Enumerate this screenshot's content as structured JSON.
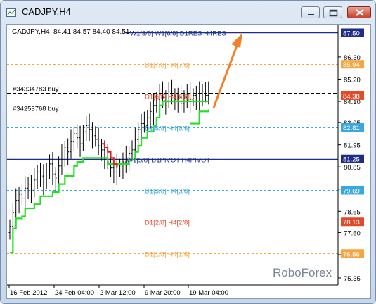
{
  "window": {
    "title": "CADJPY,H4"
  },
  "chart_info": {
    "symbol_line": "CADJPY,H4",
    "ohlc": "84.41 84.57 84.40 84.51"
  },
  "watermark": "RoboForex",
  "y_axis": {
    "ticks": [
      "86.30",
      "85.20",
      "84.10",
      "83.05",
      "81.95",
      "80.85",
      "79.75",
      "78.65",
      "77.60",
      "76.50",
      "75.35"
    ],
    "price_tags": [
      {
        "label": "87.50",
        "value": 87.5,
        "color": "#1f2d8a",
        "text_color": "#ffffff"
      },
      {
        "label": "85.94",
        "value": 85.94,
        "color": "#f4a640",
        "text_color": "#ffffff"
      },
      {
        "label": "84.38",
        "value": 84.38,
        "color": "#e34a2a",
        "text_color": "#ffffff"
      },
      {
        "label": "82.81",
        "value": 82.81,
        "color": "#3aa7e0",
        "text_color": "#ffffff"
      },
      {
        "label": "81.25",
        "value": 81.25,
        "color": "#1f2d8a",
        "text_color": "#ffffff"
      },
      {
        "label": "79.69",
        "value": 79.69,
        "color": "#3aa7e0",
        "text_color": "#ffffff"
      },
      {
        "label": "78.13",
        "value": 78.13,
        "color": "#e34a2a",
        "text_color": "#ffffff"
      },
      {
        "label": "76.56",
        "value": 76.56,
        "color": "#f4a640",
        "text_color": "#ffffff"
      }
    ]
  },
  "x_axis": {
    "ticks": [
      "16 Feb 2012",
      "24 Feb 04:00",
      "2 Mar 12:00",
      "9 Mar 20:00",
      "19 Mar 04:00"
    ]
  },
  "levels": [
    {
      "label": "W1[3/8] W1[6/8] D1RES H4RES",
      "value": 87.5,
      "color": "#1f2d8a"
    },
    {
      "label": "D1[7/8] H4[7/8]",
      "value": 85.94,
      "color": "#f4a640"
    },
    {
      "label": "D1[6/8] H4[6/8]",
      "value": 84.38,
      "color": "#e34a2a"
    },
    {
      "label": "D1[5/8] H4[5/8]",
      "value": 82.81,
      "color": "#3aa7e0"
    },
    {
      "label": "W1[5/8] D1PIVOT H4PIVOT",
      "value": 81.25,
      "color": "#1f2d8a"
    },
    {
      "label": "D1[3/8] H4[3/8]",
      "value": 79.69,
      "color": "#3aa7e0"
    },
    {
      "label": "D1[2/8] H4[2/8]",
      "value": 78.13,
      "color": "#e34a2a"
    },
    {
      "label": "D1[1/8] H4[1/8]",
      "value": 76.56,
      "color": "#f4a640"
    }
  ],
  "orders": [
    {
      "label": "#34334783 buy",
      "value": 84.51
    },
    {
      "label": "#34253768 buy",
      "value": 83.55
    }
  ],
  "chart_data": {
    "type": "candlestick",
    "ylim": [
      75.0,
      87.9
    ],
    "prices": [
      77.9,
      78.6,
      79.2,
      79.5,
      79.3,
      79.8,
      80.0,
      79.7,
      80.2,
      80.6,
      80.4,
      80.1,
      80.7,
      81.0,
      80.5,
      80.3,
      80.9,
      81.4,
      81.8,
      81.6,
      82.1,
      82.5,
      82.3,
      82.0,
      82.6,
      82.9,
      82.7,
      82.4,
      82.2,
      81.9,
      81.7,
      81.4,
      81.1,
      80.8,
      80.6,
      80.9,
      80.7,
      81.1,
      81.3,
      81.5,
      81.7,
      82.2,
      82.7,
      83.0,
      82.9,
      83.3,
      83.6,
      83.9,
      84.2,
      84.5,
      84.3,
      84.1,
      84.6,
      84.4,
      84.2,
      84.3,
      84.0,
      84.3,
      84.5,
      84.2,
      84.4,
      84.1,
      84.5,
      84.6,
      84.4,
      84.5
    ],
    "support_line": [
      76.6,
      77.8,
      78.3,
      78.3,
      78.4,
      78.8,
      78.8,
      78.8,
      79.0,
      79.0,
      79.4,
      79.4,
      79.4,
      79.4,
      79.6,
      79.6,
      80.0,
      80.0,
      80.4,
      80.4,
      80.4,
      80.9,
      81.1,
      81.1,
      81.3,
      81.3,
      81.3,
      81.3,
      81.3,
      81.3,
      81.3,
      81.3,
      81.0,
      81.0,
      81.0,
      81.0,
      81.0,
      81.0,
      81.0,
      81.2,
      81.2,
      81.6,
      81.9,
      82.3,
      82.3,
      82.6,
      82.6,
      82.9,
      83.3,
      83.9,
      84.1,
      84.1,
      84.1,
      84.1,
      84.1,
      84.1,
      84.1,
      84.1,
      84.1,
      84.1,
      84.1,
      84.1,
      84.1,
      84.1,
      84.1,
      84.1
    ],
    "support_line2": [
      83.0,
      83.0,
      83.0,
      83.6,
      83.6,
      83.6,
      83.7
    ],
    "red_segment": [
      82.0,
      81.8,
      81.6,
      81.3,
      81.0,
      80.8
    ]
  }
}
